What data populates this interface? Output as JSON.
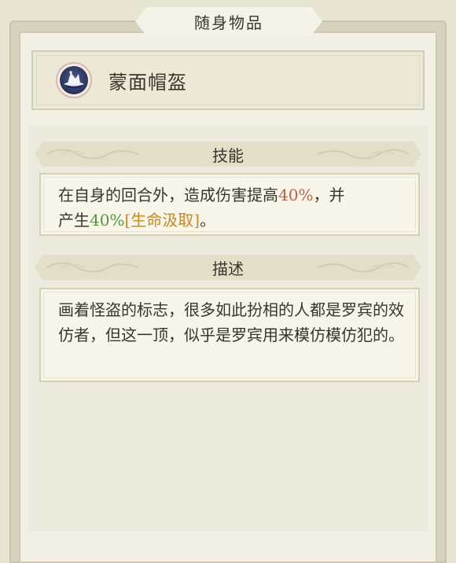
{
  "panel": {
    "title": "随身物品"
  },
  "item": {
    "name": "蒙面帽盔",
    "icon": "masked-helmet-icon"
  },
  "skill": {
    "header": "技能",
    "line1_prefix": "在自身的回合外，造成伤害提高",
    "line1_value": "40%",
    "line1_suffix": "，并",
    "line2_prefix": "产生",
    "line2_value": "40%",
    "line2_keyword": "[生命汲取]",
    "line2_suffix": "。"
  },
  "description": {
    "header": "描述",
    "text": "画着怪盗的标志，很多如此扮相的人都是罗宾的效仿者，但这一顶，似乎是罗宾用来模仿模仿犯的。"
  },
  "colors": {
    "damage_value": "#c0624a",
    "heal_value": "#4f9a3a",
    "keyword": "#c9891d"
  }
}
